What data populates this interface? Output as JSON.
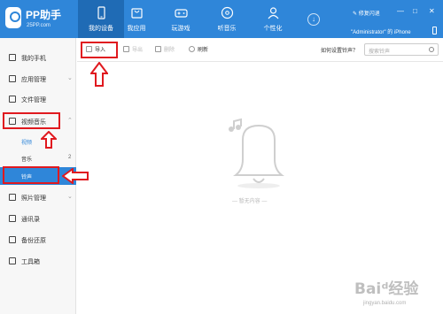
{
  "app": {
    "title": "PP助手",
    "subtitle": "25PP.com"
  },
  "nav": {
    "tabs": [
      {
        "label": "我的设备",
        "icon": "phone-icon"
      },
      {
        "label": "我应用",
        "icon": "bag-icon"
      },
      {
        "label": "玩游戏",
        "icon": "gamepad-icon"
      },
      {
        "label": "听音乐",
        "icon": "music-disc-icon"
      },
      {
        "label": "个性化",
        "icon": "person-icon"
      }
    ],
    "download_symbol": "↓"
  },
  "topbar": {
    "fix_label": "修复闪退",
    "device_name": "\"Administrator\" 的 iPhone",
    "win_controls": [
      "—",
      "□",
      "✕"
    ]
  },
  "sidebar": {
    "items": [
      {
        "label": "我的手机",
        "icon": "phone-icon"
      },
      {
        "label": "应用管理",
        "icon": "apps-grid-icon",
        "chevron": "⌄"
      },
      {
        "label": "文件管理",
        "icon": "folder-icon"
      },
      {
        "label": "视频音乐",
        "icon": "media-icon",
        "chevron": "⌃"
      },
      {
        "label": "照片管理",
        "icon": "photo-icon",
        "chevron": "⌄"
      },
      {
        "label": "通讯录",
        "icon": "contacts-icon"
      },
      {
        "label": "备份还原",
        "icon": "backup-icon"
      },
      {
        "label": "工具箱",
        "icon": "toolbox-icon"
      }
    ],
    "media_sub": [
      {
        "label": "视频"
      },
      {
        "label": "音乐",
        "count": "2"
      },
      {
        "label": "铃声"
      }
    ]
  },
  "toolbar": {
    "import_label": "导入",
    "export_label": "导出",
    "delete_label": "删除",
    "refresh_label": "刷新",
    "help_label": "如何设置铃声？",
    "search_placeholder": "搜索铃声"
  },
  "main": {
    "empty_text": "暂无内容"
  },
  "watermark": {
    "main": "Baiᵈ经验",
    "sub": "jingyan.baidu.com"
  },
  "colors": {
    "brand": "#2f86d9",
    "annotation": "#e0191f"
  }
}
